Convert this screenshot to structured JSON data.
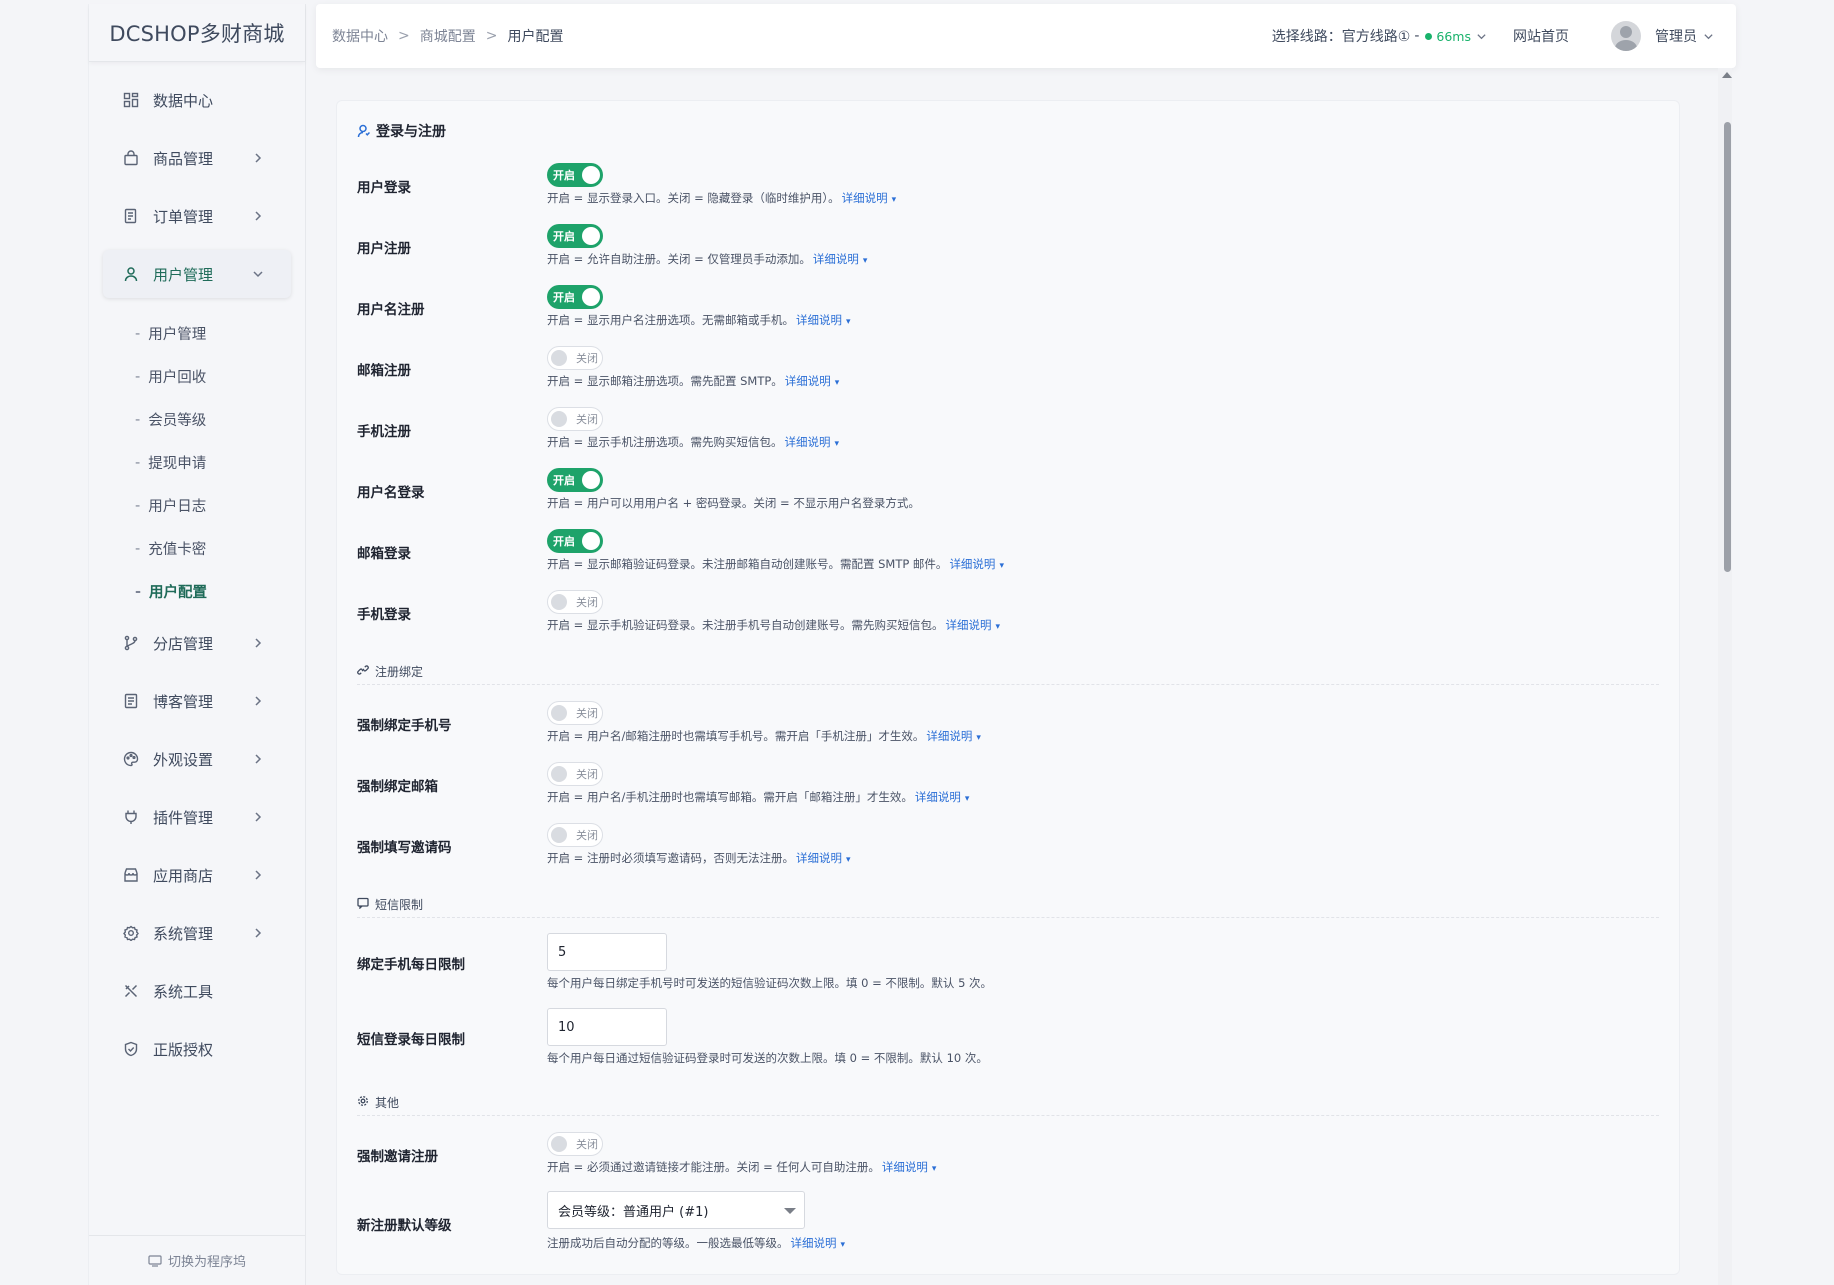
{
  "brand": "DCSHOP多财商城",
  "sidebar": {
    "items": [
      {
        "label": "数据中心",
        "icon": "dashboard-icon",
        "has_children": false
      },
      {
        "label": "商品管理",
        "icon": "bag-icon",
        "has_children": true
      },
      {
        "label": "订单管理",
        "icon": "order-icon",
        "has_children": true
      },
      {
        "label": "用户管理",
        "icon": "user-icon",
        "has_children": true,
        "expanded": true
      },
      {
        "label": "分店管理",
        "icon": "branch-icon",
        "has_children": true
      },
      {
        "label": "博客管理",
        "icon": "blog-icon",
        "has_children": true
      },
      {
        "label": "外观设置",
        "icon": "palette-icon",
        "has_children": true
      },
      {
        "label": "插件管理",
        "icon": "plugin-icon",
        "has_children": true
      },
      {
        "label": "应用商店",
        "icon": "store-icon",
        "has_children": true
      },
      {
        "label": "系统管理",
        "icon": "gear-icon",
        "has_children": true
      },
      {
        "label": "系统工具",
        "icon": "tools-icon",
        "has_children": false
      },
      {
        "label": "正版授权",
        "icon": "shield-icon",
        "has_children": false
      }
    ],
    "sub_items": [
      "用户管理",
      "用户回收",
      "会员等级",
      "提现申请",
      "用户日志",
      "充值卡密",
      "用户配置"
    ],
    "sub_dash": "-",
    "footer": "切换为程序坞"
  },
  "header": {
    "breadcrumb": [
      "数据中心",
      "商城配置",
      "用户配置"
    ],
    "breadcrumb_sep": ">",
    "route_label": "选择线路：官方线路①",
    "route_dash": "-",
    "ping": "66ms",
    "site_link": "网站首页",
    "admin": "管理员"
  },
  "form": {
    "section_title": "登录与注册",
    "more_label": "详细说明",
    "on_label": "开启",
    "off_label": "关闭",
    "login_rows": [
      {
        "label": "用户登录",
        "on": true,
        "help": "开启 = 显示登录入口。关闭 = 隐藏登录（临时维护用）。",
        "more": true
      },
      {
        "label": "用户注册",
        "on": true,
        "help": "开启 = 允许自助注册。关闭 = 仅管理员手动添加。",
        "more": true
      },
      {
        "label": "用户名注册",
        "on": true,
        "help": "开启 = 显示用户名注册选项。无需邮箱或手机。",
        "more": true
      },
      {
        "label": "邮箱注册",
        "on": false,
        "help": "开启 = 显示邮箱注册选项。需先配置 SMTP。",
        "more": true
      },
      {
        "label": "手机注册",
        "on": false,
        "help": "开启 = 显示手机注册选项。需先购买短信包。",
        "more": true
      },
      {
        "label": "用户名登录",
        "on": true,
        "help": "开启 = 用户可以用用户名 + 密码登录。关闭 = 不显示用户名登录方式。",
        "more": false
      },
      {
        "label": "邮箱登录",
        "on": true,
        "help": "开启 = 显示邮箱验证码登录。未注册邮箱自动创建账号。需配置 SMTP 邮件。",
        "more": true
      },
      {
        "label": "手机登录",
        "on": false,
        "help": "开启 = 显示手机验证码登录。未注册手机号自动创建账号。需先购买短信包。",
        "more": true
      }
    ],
    "bind_group": "注册绑定",
    "bind_rows": [
      {
        "label": "强制绑定手机号",
        "on": false,
        "help": "开启 = 用户名/邮箱注册时也需填写手机号。需开启「手机注册」才生效。",
        "more": true
      },
      {
        "label": "强制绑定邮箱",
        "on": false,
        "help": "开启 = 用户名/手机注册时也需填写邮箱。需开启「邮箱注册」才生效。",
        "more": true
      },
      {
        "label": "强制填写邀请码",
        "on": false,
        "help": "开启 = 注册时必须填写邀请码，否则无法注册。",
        "more": true
      }
    ],
    "sms_group": "短信限制",
    "sms_rows": [
      {
        "label": "绑定手机每日限制",
        "value": "5",
        "help": "每个用户每日绑定手机号时可发送的短信验证码次数上限。填 0 = 不限制。默认 5 次。"
      },
      {
        "label": "短信登录每日限制",
        "value": "10",
        "help": "每个用户每日通过短信验证码登录时可发送的次数上限。填 0 = 不限制。默认 10 次。"
      }
    ],
    "other_group": "其他",
    "invite_row": {
      "label": "强制邀请注册",
      "on": false,
      "help": "开启 = 必须通过邀请链接才能注册。关闭 = 任何人可自助注册。",
      "more": true
    },
    "level_row": {
      "label": "新注册默认等级",
      "value": "会员等级：普通用户 (#1)",
      "help": "注册成功后自动分配的等级。一般选最低等级。",
      "more": true
    }
  },
  "colors": {
    "accent": "#1ea36a",
    "active_nav": "#1f6b59",
    "link": "#2b6fd6"
  }
}
